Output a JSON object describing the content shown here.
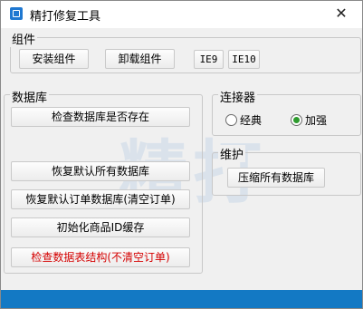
{
  "window": {
    "title": "精打修复工具",
    "close_glyph": "✕"
  },
  "components": {
    "label": "组件",
    "install_label": "安装组件",
    "uninstall_label": "卸载组件",
    "ie9_label": "IE9",
    "ie10_label": "IE10"
  },
  "database": {
    "label": "数据库",
    "check_exists_label": "检查数据库是否存在",
    "restore_all_label": "恢复默认所有数据库",
    "restore_orders_label": "恢复默认订单数据库(清空订单)",
    "init_goods_label": "初始化商品ID缓存",
    "check_structure_label": "检查数据表结构(不清空订单)"
  },
  "connector": {
    "label": "连接器",
    "options": [
      {
        "label": "经典",
        "checked": false
      },
      {
        "label": "加强",
        "checked": true
      }
    ]
  },
  "maintenance": {
    "label": "维护",
    "compress_label": "压缩所有数据库"
  },
  "watermark": "精打",
  "colors": {
    "accent": "#1379c4",
    "radio_checked": "#2e9b2e",
    "warning_text": "#d40000"
  },
  "icons": {
    "app": "app-icon",
    "close": "close-icon"
  }
}
